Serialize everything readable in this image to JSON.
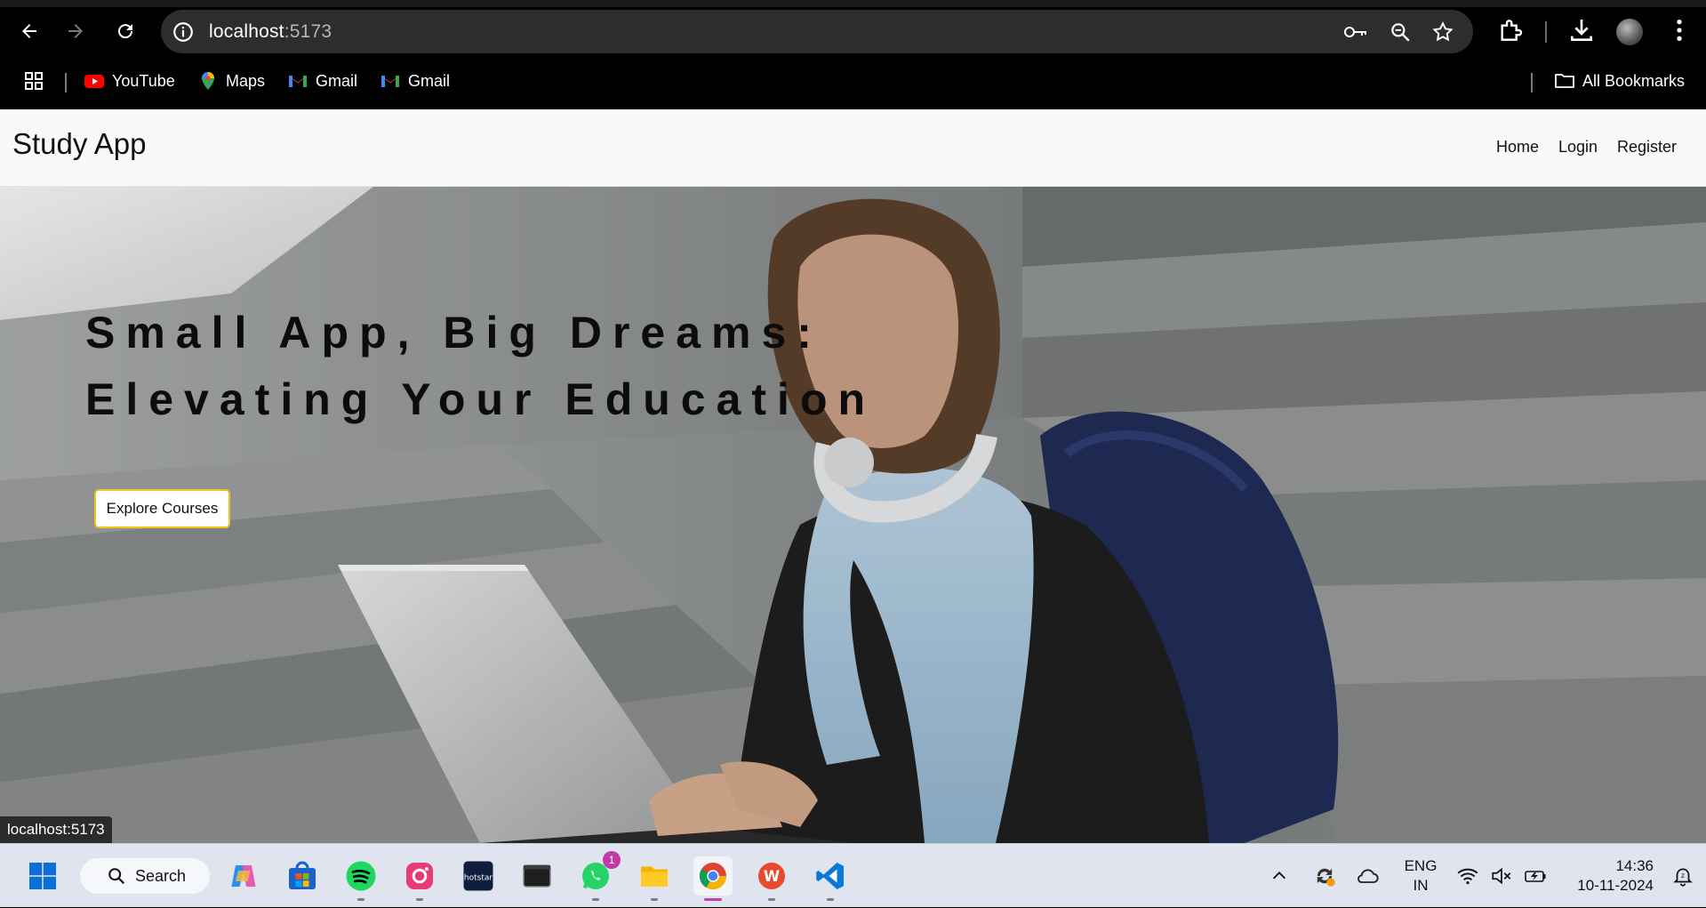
{
  "browser": {
    "url_host": "localhost",
    "url_port": ":5173",
    "bookmarks": [
      {
        "label": "YouTube",
        "icon": "youtube-icon"
      },
      {
        "label": "Maps",
        "icon": "maps-icon"
      },
      {
        "label": "Gmail",
        "icon": "gmail-icon"
      },
      {
        "label": "Gmail",
        "icon": "gmail-icon"
      }
    ],
    "all_bookmarks_label": "All Bookmarks",
    "status_tooltip": "localhost:5173"
  },
  "site": {
    "brand": "Study App",
    "nav": [
      "Home",
      "Login",
      "Register"
    ],
    "hero": {
      "headline_line1": "Small App, Big Dreams:",
      "headline_line2": "Elevating Your Education",
      "cta_label": "Explore Courses"
    }
  },
  "taskbar": {
    "search_label": "Search",
    "whatsapp_badge": "1",
    "language": "ENG",
    "region": "IN",
    "time": "14:36",
    "date": "10-11-2024"
  },
  "colors": {
    "cta_border": "#f0c419",
    "chrome_bg": "#000000",
    "navbar_bg": "#f8f9fa",
    "taskbar_bg": "#dfe4ee"
  }
}
